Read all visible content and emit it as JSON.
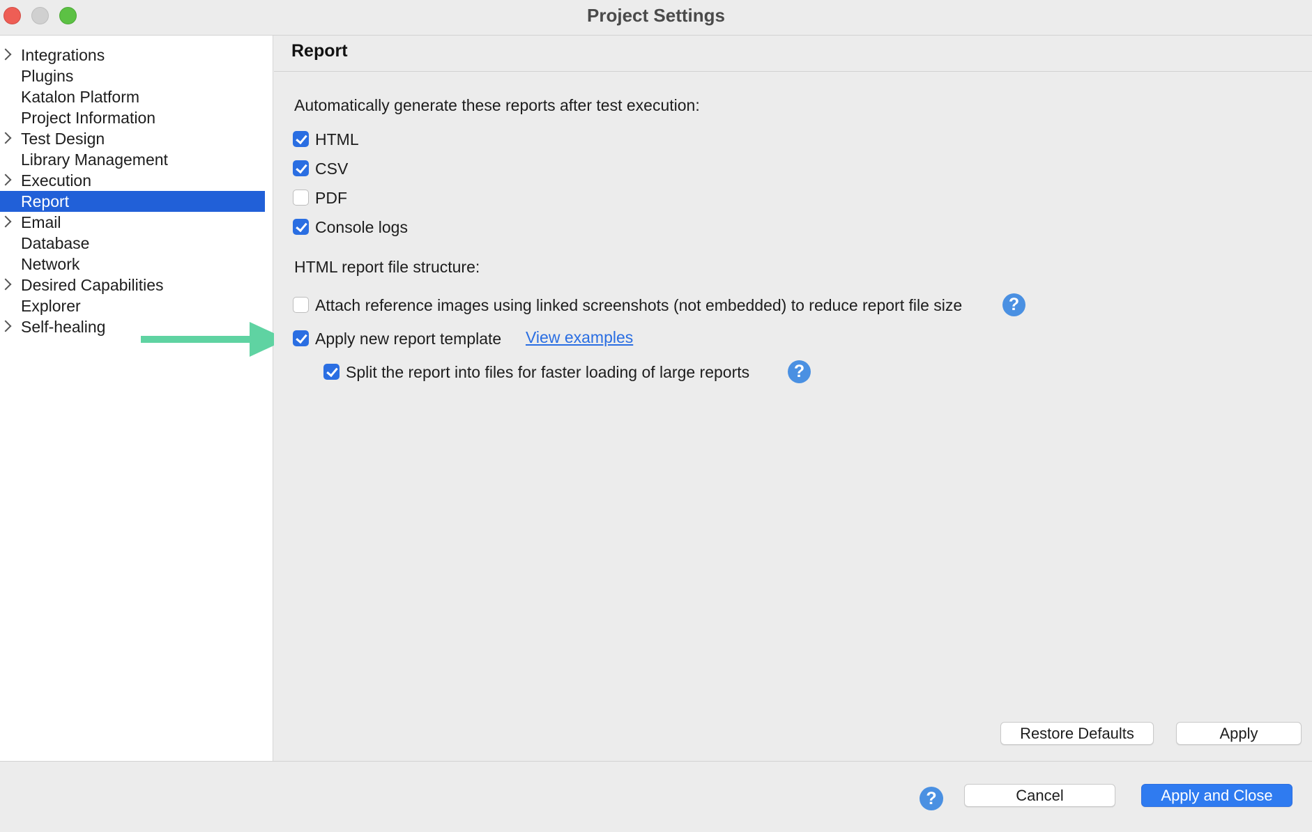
{
  "window": {
    "title": "Project Settings"
  },
  "sidebar": {
    "items": [
      {
        "label": "Integrations",
        "expandable": true,
        "selected": false
      },
      {
        "label": "Plugins",
        "expandable": false,
        "selected": false
      },
      {
        "label": "Katalon Platform",
        "expandable": false,
        "selected": false
      },
      {
        "label": "Project Information",
        "expandable": false,
        "selected": false
      },
      {
        "label": "Test Design",
        "expandable": true,
        "selected": false
      },
      {
        "label": "Library Management",
        "expandable": false,
        "selected": false
      },
      {
        "label": "Execution",
        "expandable": true,
        "selected": false
      },
      {
        "label": "Report",
        "expandable": false,
        "selected": true
      },
      {
        "label": "Email",
        "expandable": true,
        "selected": false
      },
      {
        "label": "Database",
        "expandable": false,
        "selected": false
      },
      {
        "label": "Network",
        "expandable": false,
        "selected": false
      },
      {
        "label": "Desired Capabilities",
        "expandable": true,
        "selected": false
      },
      {
        "label": "Explorer",
        "expandable": false,
        "selected": false
      },
      {
        "label": "Self-healing",
        "expandable": true,
        "selected": false
      }
    ]
  },
  "main": {
    "title": "Report",
    "auto_generate_label": "Automatically generate these reports after test execution:",
    "reports": [
      {
        "label": "HTML",
        "checked": true
      },
      {
        "label": "CSV",
        "checked": true
      },
      {
        "label": "PDF",
        "checked": false
      },
      {
        "label": "Console logs",
        "checked": true
      }
    ],
    "structure_label": "HTML report file structure:",
    "attach_reference_label": "Attach reference images using linked screenshots (not embedded) to reduce report file size",
    "attach_reference_checked": false,
    "apply_template_label": "Apply new report template",
    "apply_template_checked": true,
    "view_examples_link": "View examples",
    "split_report_label": "Split the report into files for faster loading of large reports",
    "split_report_checked": true,
    "help_glyph": "?",
    "restore_defaults_label": "Restore Defaults",
    "apply_label": "Apply"
  },
  "footer": {
    "help_glyph": "?",
    "cancel_label": "Cancel",
    "apply_close_label": "Apply and Close"
  },
  "colors": {
    "selection": "#2160d8",
    "checkbox_accent": "#2a6ee2",
    "primary_button": "#2f7bf0",
    "arrow": "#5fd3a2"
  }
}
